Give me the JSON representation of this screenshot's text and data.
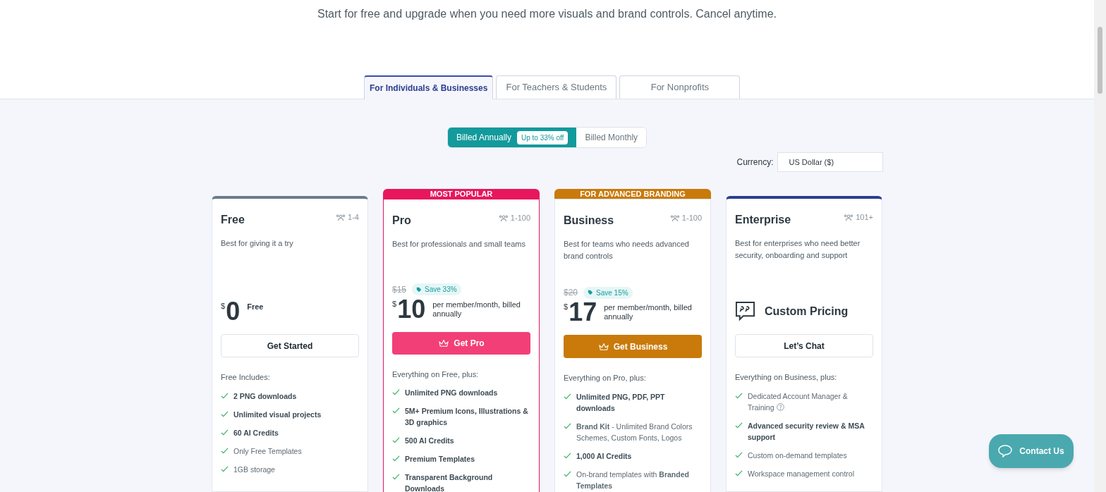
{
  "subtitle": "Start for free and upgrade when you need more visuals and brand controls. Cancel anytime.",
  "tabs": [
    {
      "label": "For Individuals & Businesses",
      "selected": true
    },
    {
      "label": "For Teachers & Students",
      "selected": false
    },
    {
      "label": "For Nonprofits",
      "selected": false
    }
  ],
  "billing": [
    {
      "label": "Billed Annually",
      "badge": "Up to 33% off",
      "selected": true
    },
    {
      "label": "Billed Monthly",
      "selected": false
    }
  ],
  "currency": {
    "label": "Currency:",
    "value": "US Dollar ($)"
  },
  "plans": [
    {
      "name": "Free",
      "color": "#6b7b89",
      "team": "1-4",
      "description": "Best for giving it a try",
      "price": {
        "kind": "amount",
        "currency": "$",
        "amount": "0",
        "note": "Free"
      },
      "button": {
        "label": "Get Started",
        "kind": "outline",
        "crown": false
      },
      "includes": "Free Includes:",
      "features": [
        {
          "text": "2 PNG downloads",
          "strong": true,
          "help": false
        },
        {
          "text": "Unlimited visual projects",
          "strong": true,
          "help": false
        },
        {
          "text": "60 AI Credits",
          "strong": true,
          "help": false
        },
        {
          "text": "Only Free Templates",
          "strong": false,
          "help": false
        },
        {
          "text": "1GB storage",
          "strong": false,
          "help": false
        }
      ]
    },
    {
      "name": "Pro",
      "color": "#e8175d",
      "banner": "MOST POPULAR",
      "team": "1-100",
      "description": "Best for professionals and small teams",
      "price": {
        "kind": "amount",
        "old": "$15",
        "save": "Save 33%",
        "currency": "$",
        "amount": "10",
        "note": "per member/month, billed annually"
      },
      "button": {
        "label": "Get Pro",
        "kind": "filled",
        "crown": true
      },
      "includes": "Everything on Free, plus:",
      "features": [
        {
          "text": "Unlimited PNG downloads",
          "strong": true,
          "help": false
        },
        {
          "text": "5M+ Premium Icons, Illustrations & 3D graphics",
          "strong": true,
          "help": false
        },
        {
          "text": "500 AI Credits",
          "strong": true,
          "help": false
        },
        {
          "text": "Premium Templates",
          "strong": true,
          "help": false
        },
        {
          "text": "Transparent Background Downloads",
          "strong": true,
          "help": false
        }
      ]
    },
    {
      "name": "Business",
      "color": "#c97a0a",
      "banner": "FOR ADVANCED BRANDING",
      "team": "1-100",
      "description": "Best for teams who needs advanced brand controls",
      "price": {
        "kind": "amount",
        "old": "$20",
        "save": "Save 15%",
        "currency": "$",
        "amount": "17",
        "note": "per member/month, billed annually"
      },
      "button": {
        "label": "Get Business",
        "kind": "filled",
        "crown": true
      },
      "includes": "Everything on Pro, plus:",
      "features": [
        {
          "text": "Unlimited PNG, PDF, PPT downloads",
          "strong": true,
          "help": false
        },
        {
          "text": "**Brand Kit** - Unlimited Brand Colors Schemes, Custom Fonts, Logos",
          "strong": false,
          "help": false
        },
        {
          "text": "1,000 AI Credits",
          "strong": true,
          "help": false
        },
        {
          "text": "On-brand templates with **Branded Templates**",
          "strong": false,
          "help": false
        }
      ]
    },
    {
      "name": "Enterprise",
      "color": "#2b3f8f",
      "team": "101+",
      "description": "Best for enterprises who need better security, onboarding and support",
      "price": {
        "kind": "custom",
        "label": "Custom Pricing"
      },
      "button": {
        "label": "Let’s Chat",
        "kind": "outline",
        "crown": false
      },
      "includes": "Everything on Business, plus:",
      "features": [
        {
          "text": "Dedicated Account Manager & Training",
          "strong": false,
          "help": true
        },
        {
          "text": "Advanced security review & MSA support",
          "strong": true,
          "help": false
        },
        {
          "text": "Custom on-demand templates",
          "strong": false,
          "help": false
        },
        {
          "text": "Workspace management control",
          "strong": false,
          "help": false
        }
      ]
    }
  ],
  "contact_button": "Contact Us"
}
